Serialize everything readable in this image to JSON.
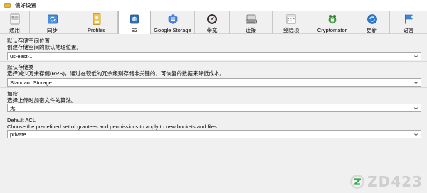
{
  "window": {
    "title": "偏好设置"
  },
  "toolbar": {
    "tabs": [
      {
        "label": "通用",
        "icon": "general-icon"
      },
      {
        "label": "同步",
        "icon": "sync-icon"
      },
      {
        "label": "Profiles",
        "icon": "profiles-icon"
      },
      {
        "label": "S3",
        "icon": "s3-icon",
        "active": true
      },
      {
        "label": "Google Storage",
        "icon": "google-storage-icon"
      },
      {
        "label": "带宽",
        "icon": "bandwidth-icon"
      },
      {
        "label": "连接",
        "icon": "connection-icon"
      },
      {
        "label": "登陆项",
        "icon": "login-items-icon"
      },
      {
        "label": "Cryptomator",
        "icon": "cryptomator-icon"
      },
      {
        "label": "更新",
        "icon": "update-icon"
      },
      {
        "label": "语言",
        "icon": "language-icon"
      }
    ]
  },
  "sections": {
    "location": {
      "heading": "默认存储空间位置",
      "desc": "创建存储空间的默认地理位置。",
      "value": "us-east-1"
    },
    "storage_class": {
      "heading": "默认存储类",
      "desc": "选择减少冗余存储(RRS)，通过在较低的冗余级别存储非关键的，可恢复的数据来降低成本。",
      "value": "Standard Storage"
    },
    "encryption": {
      "heading": "加密",
      "desc": "选择上传时加密文件的算法。",
      "value": "无"
    },
    "acl": {
      "heading": "Default ACL",
      "desc": "Choose the predefined set of grantees and permissions to apply to new buckets and files.",
      "value": "private"
    }
  },
  "watermark": {
    "text": "ZD423"
  },
  "colors": {
    "accent_blue": "#1e73c8",
    "border": "#a8a8a8"
  }
}
